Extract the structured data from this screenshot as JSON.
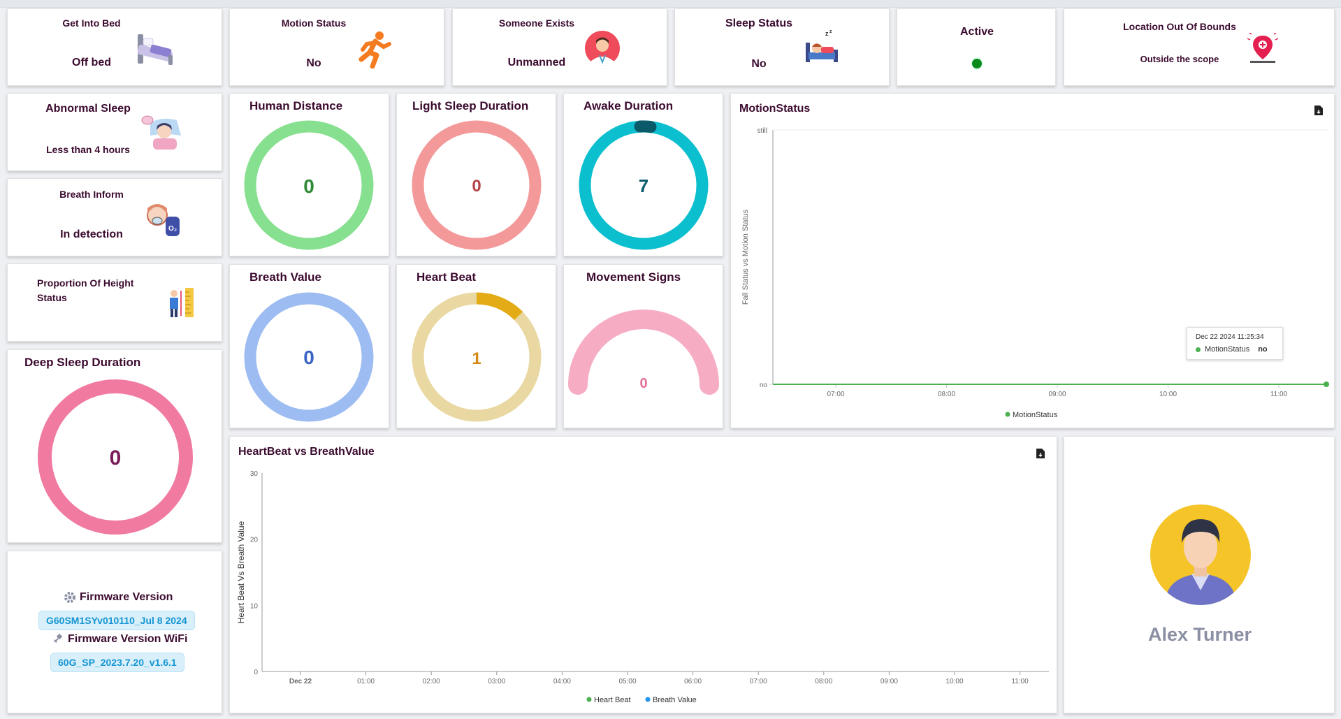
{
  "status_cards": [
    {
      "title": "Get Into Bed",
      "value": "Off bed",
      "icon": "bed-icon"
    },
    {
      "title": "Motion Status",
      "value": "No",
      "icon": "running-person-icon"
    },
    {
      "title": "Someone Exists",
      "value": "Unmanned",
      "icon": "doctor-avatar-icon"
    },
    {
      "title": "Sleep Status",
      "value": "No",
      "icon": "sleeping-person-icon"
    },
    {
      "title": "Active",
      "value": "",
      "icon": "green-dot-icon"
    },
    {
      "title": "Location Out Of Bounds",
      "value": "Outside the scope",
      "icon": "location-pin-icon"
    }
  ],
  "side_cards": {
    "abnormal_sleep": {
      "title": "Abnormal Sleep",
      "value": "Less than 4 hours"
    },
    "breath_inform": {
      "title": "Breath Inform",
      "value": "In detection"
    },
    "height_status": {
      "title_line1": "Proportion Of Height",
      "title_line2": "Status"
    }
  },
  "gauges": {
    "deep_sleep": {
      "title": "Deep Sleep Duration",
      "value": "0",
      "color": "#f07aa0",
      "text_color": "#7a1c5a",
      "progress": 0
    },
    "human_distance": {
      "title": "Human Distance",
      "value": "0",
      "color": "#86e08f",
      "text_color": "#2e8b35",
      "progress": 0
    },
    "light_sleep": {
      "title": "Light Sleep Duration",
      "value": "0",
      "color": "#f4999a",
      "text_color": "#b64344",
      "progress": 0
    },
    "awake": {
      "title": "Awake Duration",
      "value": "7",
      "color": "#0bbfcf",
      "text_color": "#0a5a6a",
      "progress": 0.02
    },
    "breath_value": {
      "title": "Breath Value",
      "value": "0",
      "color": "#9dbcf2",
      "text_color": "#3a65c4",
      "progress": 0
    },
    "heart_beat": {
      "title": "Heart Beat",
      "value": "1",
      "color": "#e9d8a2",
      "accent": "#e3ac17",
      "text_color": "#d68a14",
      "progress": 0.15
    },
    "movement": {
      "title": "Movement Signs",
      "value": "0",
      "color": "#f6adc4",
      "text_color": "#e46f95",
      "progress": 0
    }
  },
  "motion_chart": {
    "title": "MotionStatus",
    "y_axis_label": "Fall Status vs Motion Status",
    "y_ticks": [
      "still",
      "no"
    ],
    "x_ticks": [
      "07:00",
      "08:00",
      "09:00",
      "10:00",
      "11:00"
    ],
    "legend": "MotionStatus",
    "line_color": "#4caf50",
    "tooltip": {
      "time": "Dec 22 2024 11:25:34",
      "series": "MotionStatus",
      "value": "no"
    }
  },
  "heart_chart": {
    "title": "HeartBeat vs BreathValue",
    "y_axis_label": "Heart Beat Vs Breath Value",
    "y_ticks": [
      "30",
      "20",
      "10",
      "0"
    ],
    "x_ticks": [
      "Dec 22",
      "01:00",
      "02:00",
      "03:00",
      "04:00",
      "05:00",
      "06:00",
      "07:00",
      "08:00",
      "09:00",
      "10:00",
      "11:00"
    ],
    "legend": [
      {
        "name": "Heart Beat",
        "color": "#4caf50"
      },
      {
        "name": "Breath Value",
        "color": "#2196f3"
      }
    ]
  },
  "firmware": {
    "title": "Firmware Version",
    "version": "G60SM1SYv010110_Jul 8 2024",
    "wifi_title": "Firmware Version WiFi",
    "wifi_version": "60G_SP_2023.7.20_v1.6.1"
  },
  "user": {
    "name": "Alex Turner"
  },
  "chart_data": [
    {
      "type": "line",
      "title": "MotionStatus",
      "ylabel": "Fall Status vs Motion Status",
      "x": [
        "07:00",
        "08:00",
        "09:00",
        "10:00",
        "11:00",
        "11:25:34"
      ],
      "series": [
        {
          "name": "MotionStatus",
          "values": [
            "no",
            "no",
            "no",
            "no",
            "no",
            "no"
          ]
        }
      ],
      "y_categories": [
        "no",
        "still"
      ]
    },
    {
      "type": "line",
      "title": "HeartBeat vs BreathValue",
      "ylabel": "Heart Beat Vs Breath Value",
      "ylim": [
        0,
        30
      ],
      "x": [
        "Dec 22",
        "01:00",
        "02:00",
        "03:00",
        "04:00",
        "05:00",
        "06:00",
        "07:00",
        "08:00",
        "09:00",
        "10:00",
        "11:00"
      ],
      "series": [
        {
          "name": "Heart Beat",
          "values": []
        },
        {
          "name": "Breath Value",
          "values": []
        }
      ]
    }
  ]
}
